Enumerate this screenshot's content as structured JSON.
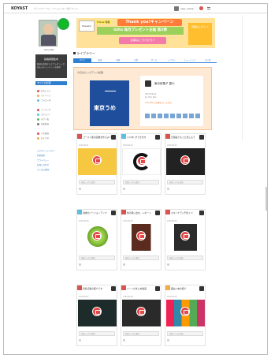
{
  "header": {
    "logo": "KOYAST",
    "note": "ダンスサークル・クリエイター紹介サイト",
    "username": "user_name"
  },
  "sidebar": {
    "name": "Yuki_Mai",
    "dark_title": "投稿者募集中",
    "dark_text": "動画を投稿するとプレゼントが当たるキャンペーン実施中",
    "selected": "すべての記事",
    "items": [
      {
        "label": "お気に入り",
        "color": "#d9534f"
      },
      {
        "label": "マイページ",
        "color": "#f0ad4e"
      },
      {
        "label": "フォロー中",
        "color": "#5bc0de"
      },
      {
        "label": "ランキング",
        "color": "#d9534f"
      },
      {
        "label": "カテゴリー",
        "color": "#5bc0de"
      },
      {
        "label": "タグ一覧",
        "color": "#5cb85c"
      },
      {
        "label": "新着動画",
        "color": "#777"
      },
      {
        "label": "人気動画",
        "color": "#d9534f"
      },
      {
        "label": "おすすめ",
        "color": "#f0ad4e"
      }
    ],
    "links": [
      "このサイトについて",
      "利用規約",
      "プライバシー",
      "お問い合わせ",
      "よくある質問"
    ]
  },
  "banner": {
    "left_label": "Present",
    "highlight": "Follow 特典",
    "title": "Thank you!キャンペーン",
    "subtitle": "Gifts 毎月プレゼント企画 第2弾",
    "pink": "応募はこちらから!!",
    "right": "詳細はこちら ＞"
  },
  "page_title": "ライブラリー",
  "tabs": [
    "すべて",
    "動画",
    "画像",
    "記事",
    "ダンス",
    "イラスト",
    "ミュージック",
    "その他"
  ],
  "featured": {
    "label": "今日のピックアップ記事",
    "book_title": "東京うめ",
    "name": "東京和菓子 屋の",
    "meta": [
      "2019.09.01",
      "by Yuki_Mai"
    ],
    "link": "Yuki_Mai の記事をもっと見る"
  },
  "cards": [
    {
      "title": "ゴースト風の画像を作るよ!!",
      "meta": "2019.09.01",
      "footer": "お気に入りに追加",
      "flag": "#d9534f",
      "img": "yellow"
    },
    {
      "title": "いいね! ができます",
      "meta": "2019.09.02",
      "footer": "お気に入りに追加",
      "flag": "#5bc0de",
      "img": "circle"
    },
    {
      "title": "日用品でもっと楽しもう",
      "meta": "2019.09.03",
      "footer": "お気に入りに追加",
      "flag": "#d9534f",
      "img": "dark"
    },
    {
      "title": "週末のバージョンアップ",
      "meta": "2019.09.04",
      "footer": "お気に入りに追加",
      "flag": "#5bc0de",
      "img": "green"
    },
    {
      "title": "旅の思い出を。レポート",
      "meta": "2019.09.05",
      "footer": "お気に入りに追加",
      "flag": "#d9534f",
      "img": "cups"
    },
    {
      "title": "スキンケア入門ガイド",
      "meta": "2019.09.06",
      "footer": "お気に入りに追加",
      "flag": "#d9534f",
      "img": "chair"
    },
    {
      "title": "新着記事の紹介です",
      "meta": "2019.09.07",
      "footer": "お気に入りに追加",
      "flag": "#d9534f",
      "img": "teal"
    },
    {
      "title": "シーンのまとめ動画",
      "meta": "2019.09.08",
      "footer": "お気に入りに追加",
      "flag": "#d9534f",
      "img": "white"
    },
    {
      "title": "面白い本の紹介",
      "meta": "2019.09.09",
      "footer": "お気に入りに追加",
      "flag": "#f0ad4e",
      "img": "books"
    }
  ]
}
